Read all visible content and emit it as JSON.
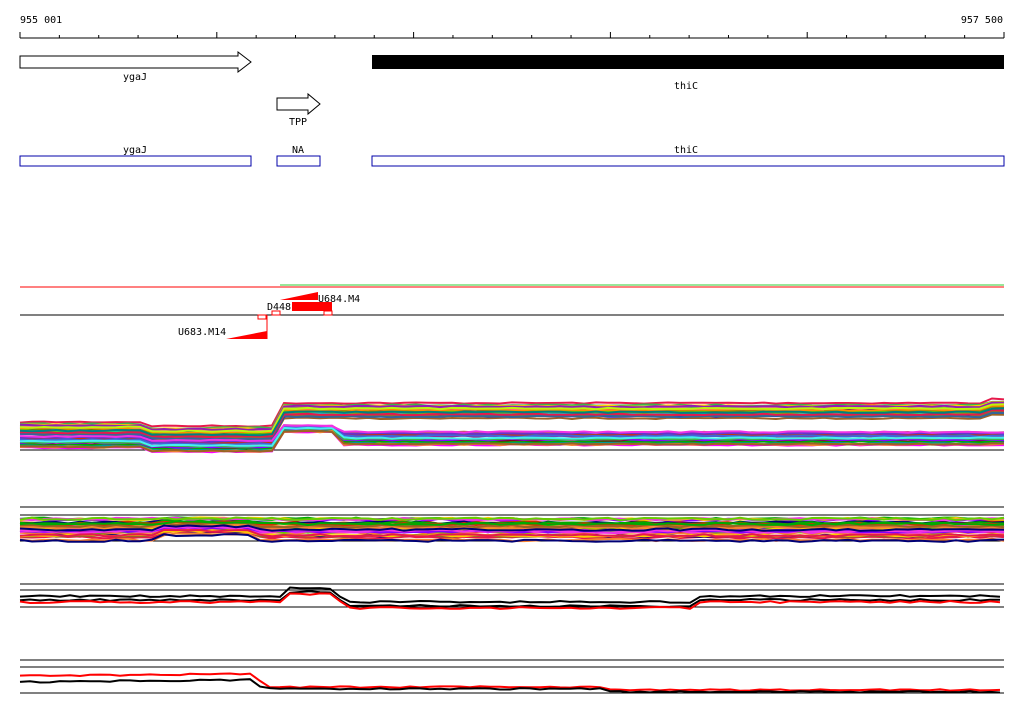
{
  "ruler": {
    "start_label": "955 001",
    "end_label": "957 500"
  },
  "genes": [
    {
      "name": "ygaJ",
      "strand": "+",
      "style": "outline"
    },
    {
      "name": "thiC",
      "strand": "+",
      "style": "filled"
    },
    {
      "name": "TPP",
      "strand": "+",
      "style": "outline"
    }
  ],
  "regions": [
    {
      "label": "ygaJ"
    },
    {
      "label": "NA"
    },
    {
      "label": "thiC"
    }
  ],
  "probes": [
    {
      "name": "D448"
    },
    {
      "name": "U684.M4"
    },
    {
      "name": "U683.M14"
    }
  ],
  "colors": {
    "region_outline": "#0000aa",
    "probe_fill": "#ff0000",
    "gene_filled": "#000000",
    "palette": [
      "#e6194b",
      "#3cb44b",
      "#4363d8",
      "#f58231",
      "#911eb4",
      "#46f0f0",
      "#f032e6",
      "#bcf60c",
      "#008080",
      "#9a6324",
      "#800000",
      "#808000",
      "#000075",
      "#aa6e28",
      "#ff00ff",
      "#00aa00",
      "#0000ff",
      "#ff8800",
      "#8800ff",
      "#00cccc",
      "#cc0066",
      "#66cc00",
      "#996633",
      "#336699",
      "#cc3300",
      "#339966",
      "#6633cc",
      "#ffcc00",
      "#ff6699",
      "#009999"
    ]
  }
}
